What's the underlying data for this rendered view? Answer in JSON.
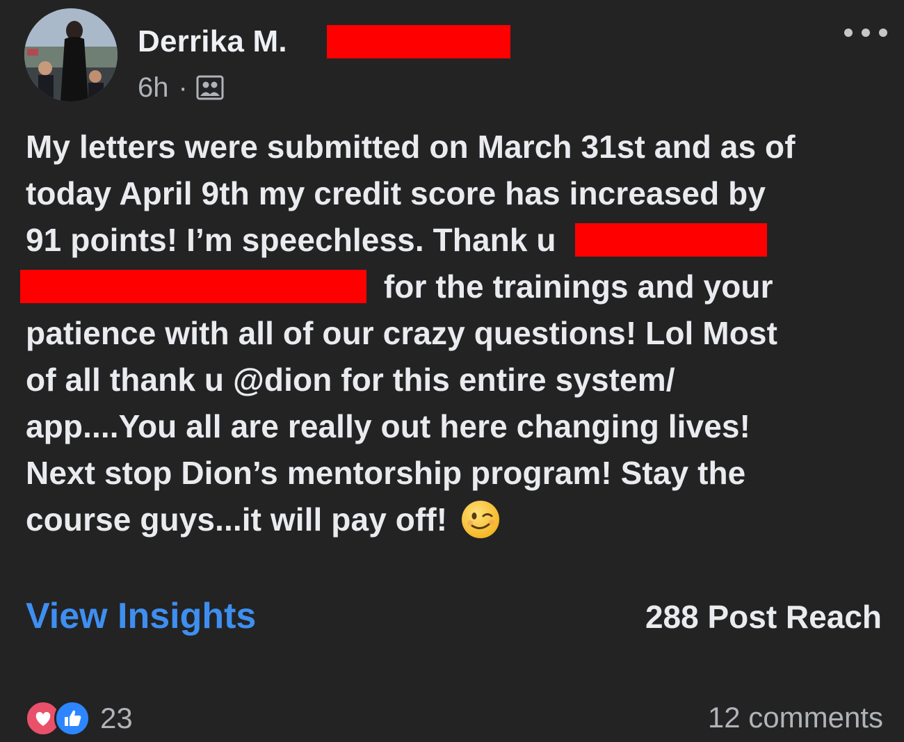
{
  "post": {
    "author": "Derrika M.",
    "time": "6h",
    "separator": "·",
    "privacy_icon": "group-members-icon",
    "more_icon": "more-options-icon",
    "text_lines": [
      "My letters were submitted on March 31st and as of",
      "today April 9th my credit score has increased by",
      "91 points! I’m speechless. Thank u",
      "for the trainings and your",
      "patience with all of our crazy questions! Lol Most",
      "of all thank u @dion for this entire system/",
      "app....You all are really out here changing lives!",
      "Next stop Dion’s mentorship program! Stay the",
      "course guys...it will pay off!"
    ],
    "emoji": "winking-face-icon",
    "redaction_color": "#ff0000"
  },
  "footer": {
    "insights_label": "View Insights",
    "reach_label": "288 Post Reach",
    "reaction_icons": [
      "love-reaction-icon",
      "like-reaction-icon"
    ],
    "reaction_count": "23",
    "comments_label": "12 comments"
  },
  "colors": {
    "background": "#232324",
    "link": "#3e8ff0",
    "text": "#e9ebee",
    "muted": "#b0b3b8"
  }
}
